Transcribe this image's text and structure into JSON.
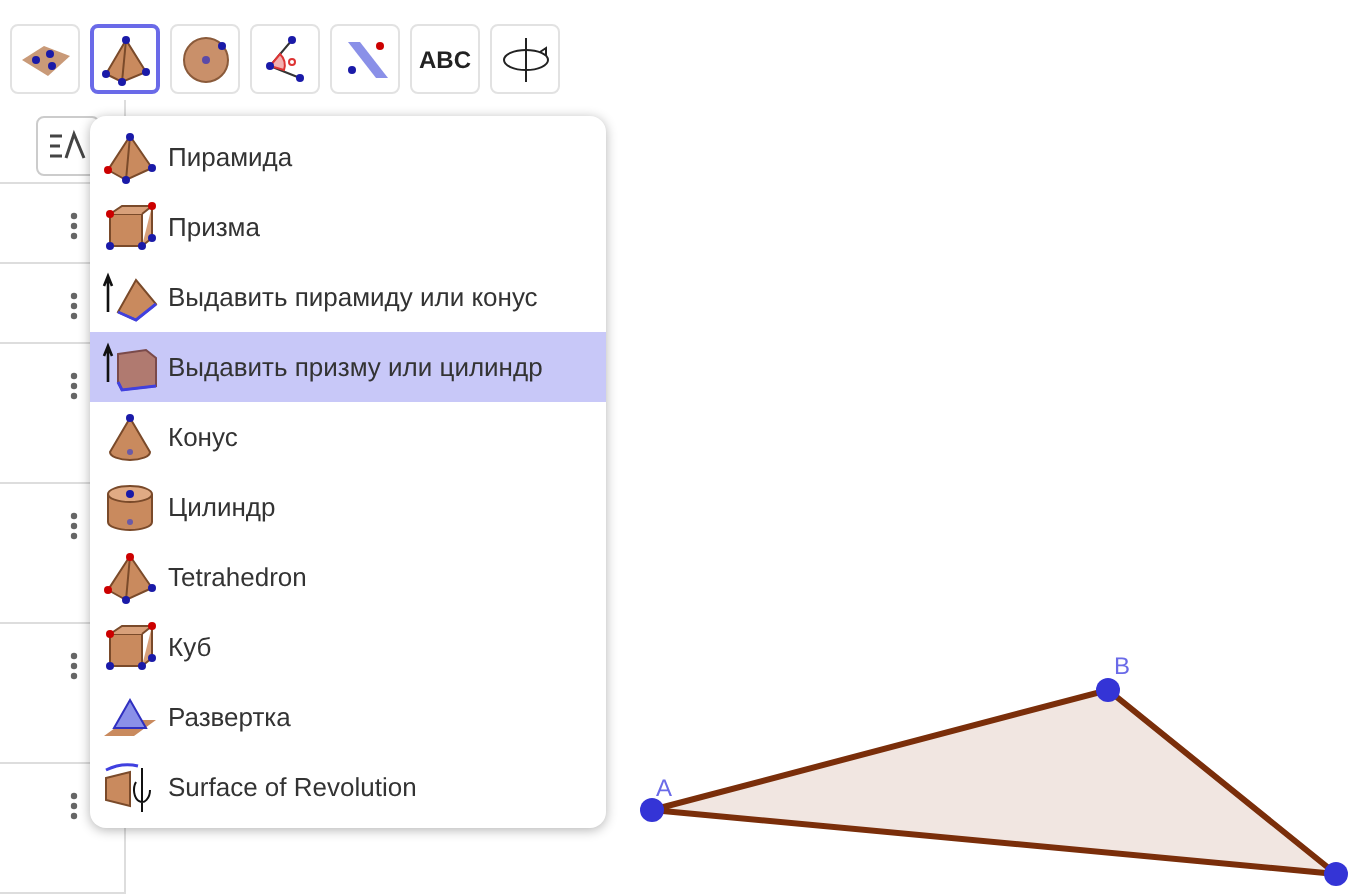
{
  "toolbar": {
    "tools": [
      {
        "kind": "polygon",
        "selected": false
      },
      {
        "kind": "pyramid",
        "selected": true
      },
      {
        "kind": "sphere",
        "selected": false
      },
      {
        "kind": "angle",
        "selected": false
      },
      {
        "kind": "plane",
        "selected": false
      },
      {
        "kind": "text",
        "label": "ABC",
        "selected": false
      },
      {
        "kind": "rotate",
        "selected": false
      }
    ]
  },
  "tool_menu": {
    "items": [
      {
        "kind": "pyramid",
        "label": "Пирамида",
        "selected": false
      },
      {
        "kind": "prism",
        "label": "Призма",
        "selected": false
      },
      {
        "kind": "extrude-pyramid",
        "label": "Выдавить пирамиду или конус",
        "selected": false
      },
      {
        "kind": "extrude-prism",
        "label": "Выдавить призму или цилиндр",
        "selected": true
      },
      {
        "kind": "cone",
        "label": "Конус",
        "selected": false
      },
      {
        "kind": "cylinder",
        "label": "Цилиндр",
        "selected": false
      },
      {
        "kind": "tetrahedron",
        "label": "Tetrahedron",
        "selected": false
      },
      {
        "kind": "cube",
        "label": "Куб",
        "selected": false
      },
      {
        "kind": "net",
        "label": "Развертка",
        "selected": false
      },
      {
        "kind": "revolution",
        "label": "Surface of Revolution",
        "selected": false
      }
    ]
  },
  "canvas": {
    "points": [
      {
        "label": "A"
      },
      {
        "label": "B"
      }
    ]
  }
}
